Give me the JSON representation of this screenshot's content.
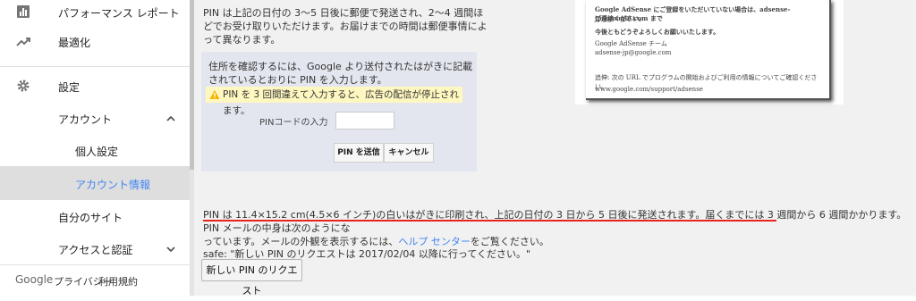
{
  "sidebar": {
    "items": [
      {
        "label": "パフォーマンス レポート",
        "icon": "bar-chart-icon"
      },
      {
        "label": "最適化",
        "icon": "trending-up-icon"
      },
      {
        "label": "設定",
        "icon": "gear-icon"
      },
      {
        "label": "アカウント",
        "icon": "chevron-up-icon"
      },
      {
        "label": "個人設定"
      },
      {
        "label": "アカウント情報"
      },
      {
        "label": "自分のサイト"
      },
      {
        "label": "アクセスと認証",
        "icon": "chevron-down-icon"
      }
    ],
    "active_index": 5,
    "footer": {
      "brand": "Google",
      "privacy": "プライバシー",
      "terms": "利用規約"
    }
  },
  "main": {
    "intro_text": "PIN は上記の日付の 3〜5 日後に郵便で発送され、2〜4 週間ほどでお受け取りいただけます。お届けまでの時間は郵便事情によって異なります。",
    "letter": {
      "line1": "Google AdSense にご登録をいただいていない場合は、adsense-jp@google.com まで",
      "line2": "ご連絡ください。",
      "line3": "今後ともどうぞよろしくお願いいたします。",
      "line4": "Google AdSense チーム",
      "line5": "adsense-jp@google.com",
      "line6": "追伸: 次の URL でプログラムの開始およびご利用の情報についてご確認ください。",
      "line7": "www.google.com/support/adsense"
    },
    "pin_box": {
      "instruction": "住所を確認するには、Google より送付されたはがきに記載されているとおりに PIN を入力します。",
      "warning": "PIN を 3 回間違えて入力すると、広告の配信が停止されます。",
      "input_label": "PINコードの入力",
      "input_value": "",
      "submit_label": "PIN を送信",
      "cancel_label": "キャンセル"
    },
    "body_text_highlight": "PIN は 11.4×15.2 cm(4.5×6 インチ)の白いはがきに印刷され、上記の日付の 3 日から 5 日後に発送されます。届くまでには 3 週間から 6 週間かかります。",
    "body_text_rest": "PIN メールの中身は次のようにな",
    "body_text_line2a": "っています。メールの外観を表示するには、",
    "help_link": "ヘルプ センター",
    "body_text_line2b": "をご覧ください。",
    "safe_text": "safe: \"新しい PIN のリクエストは 2017/02/04 以降に行ってください。\"",
    "request_button": "新しい PIN のリクエスト"
  },
  "colors": {
    "accent": "#4285f4",
    "underline": "#e8231d",
    "warning_bg": "#fff7c0",
    "pin_box_bg": "#e3e6ee"
  }
}
